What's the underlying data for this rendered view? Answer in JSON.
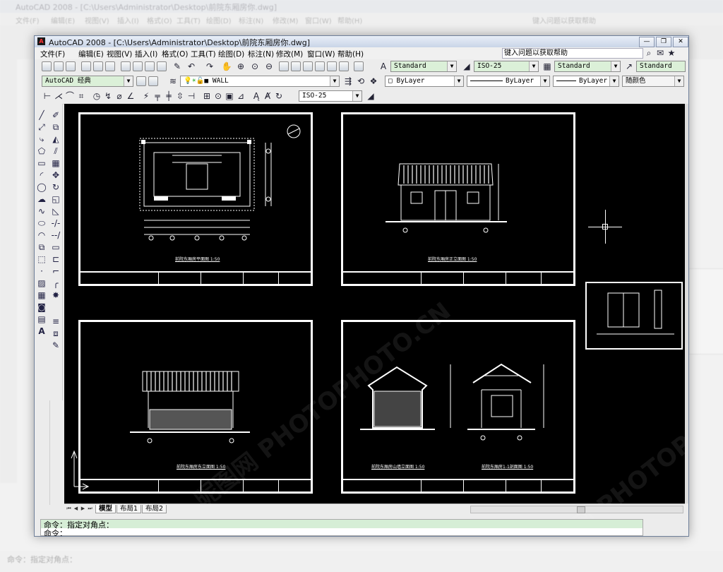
{
  "background": {
    "title": "AutoCAD 2008 - [C:\\Users\\Administrator\\Desktop\\前院东厢房你.dwg]",
    "menu": [
      "文件(F)",
      "编辑(E)",
      "视图(V)",
      "插入(I)",
      "格式(O)",
      "工具(T)",
      "绘图(D)",
      "标注(N)",
      "修改(M)",
      "窗口(W)",
      "帮助(H)"
    ],
    "help_placeholder": "键入问题以获取帮助",
    "command_text": "命令：指定对角点："
  },
  "window": {
    "title": "AutoCAD 2008 - [C:\\Users\\Administrator\\Desktop\\前院东厢房你.dwg]",
    "app_icon": "autocad-icon",
    "controls": {
      "minimize": "—",
      "restore": "❐",
      "close": "✕"
    }
  },
  "menubar": {
    "items": [
      "文件(F)",
      "编辑(E)",
      "视图(V)",
      "插入(I)",
      "格式(O)",
      "工具(T)",
      "绘图(D)",
      "标注(N)",
      "修改(M)",
      "窗口(W)",
      "帮助(H)"
    ],
    "help_placeholder": "键入问题以获取帮助"
  },
  "toolbar": {
    "text_style": "Standard",
    "dim_style": "ISO-25",
    "table_style": "Standard",
    "mleader_style": "Standard",
    "workspace": "AutoCAD 经典",
    "layer": "WALL",
    "color": "ByLayer",
    "linetype": "ByLayer",
    "lineweight": "ByLayer",
    "plotstyle": "随颜色",
    "dim_style_2": "ISO-25"
  },
  "drawings": [
    {
      "caption": "前院东厢房平面图 1:50"
    },
    {
      "caption": "前院东厢房正立面图 1:50"
    },
    {
      "caption": "前院东厢房东立面图 1:50"
    },
    {
      "caption": "前院东厢房山墙立面图 1:50"
    },
    {
      "caption": "前院东厢房1-1剖面图 1:50"
    }
  ],
  "tabs": [
    "模型",
    "布局1",
    "布局2"
  ],
  "command": {
    "line1": "命令：指定对角点：",
    "line2": "命令："
  },
  "watermark": "昵图网 PHOTOPHOTO.CN"
}
